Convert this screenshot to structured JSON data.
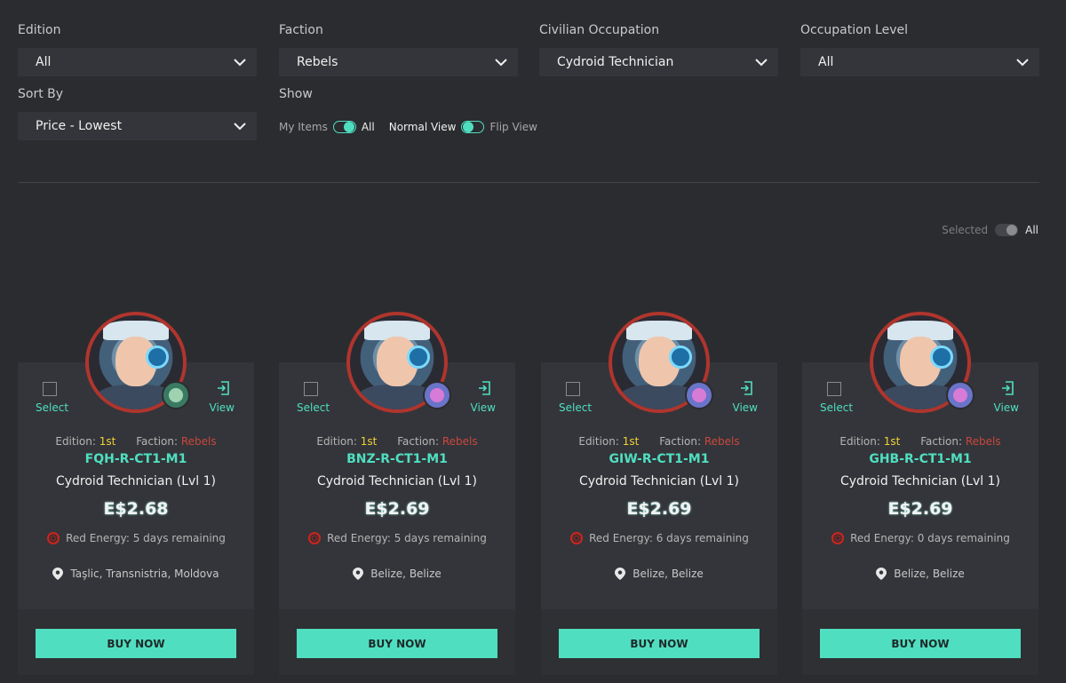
{
  "filters": [
    {
      "label": "Edition",
      "value": "All"
    },
    {
      "label": "Faction",
      "value": "Rebels"
    },
    {
      "label": "Civilian Occupation",
      "value": "Cydroid Technician"
    },
    {
      "label": "Occupation Level",
      "value": "All"
    },
    {
      "label": "Sort By",
      "value": "Price - Lowest"
    }
  ],
  "show": {
    "label": "Show",
    "my_items": "My Items",
    "all": "All",
    "normal_view": "Normal View",
    "flip_view": "Flip View"
  },
  "selected_toggle": {
    "selected": "Selected",
    "all": "All"
  },
  "card_common": {
    "edition_label": "Edition:",
    "edition_value": "1st",
    "faction_label": "Faction:",
    "faction_value": "Rebels",
    "occupation": "Cydroid Technician (Lvl 1)",
    "select_label": "Select",
    "view_label": "View",
    "buy_label": "BUY NOW"
  },
  "cards": [
    {
      "code": "FQH-R-CT1-M1",
      "price": "E$2.68",
      "energy": "Red Energy: 5 days remaining",
      "location": "Taşlic, Transnistria, Moldova",
      "badge": "green"
    },
    {
      "code": "BNZ-R-CT1-M1",
      "price": "E$2.69",
      "energy": "Red Energy: 5 days remaining",
      "location": "Belize, Belize",
      "badge": "purple"
    },
    {
      "code": "GIW-R-CT1-M1",
      "price": "E$2.69",
      "energy": "Red Energy: 6 days remaining",
      "location": "Belize, Belize",
      "badge": "purple"
    },
    {
      "code": "GHB-R-CT1-M1",
      "price": "E$2.69",
      "energy": "Red Energy: 0 days remaining",
      "location": "Belize, Belize",
      "badge": "purple"
    }
  ],
  "colors": {
    "accent": "#4fdfc0",
    "faction": "#c9473c",
    "edition": "#f0d236",
    "background": "#2b2c30"
  }
}
